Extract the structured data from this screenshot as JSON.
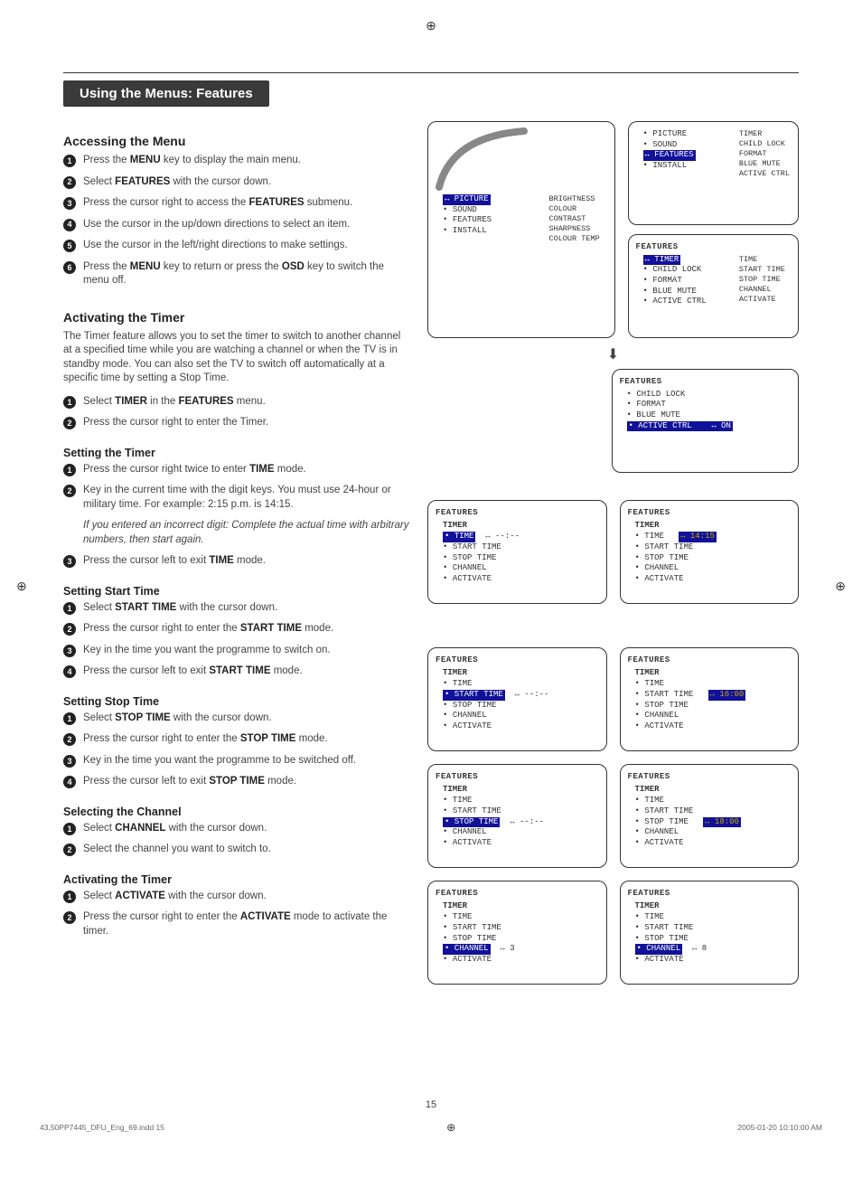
{
  "page_number": "15",
  "print_mark_glyph": "⊕",
  "title_bar": "Using the Menus: Features",
  "footer_left": "43,50PP7445_DFU_Eng_69.indd   15",
  "footer_right": "2005-01-20   10:10:00 AM",
  "sections": {
    "accessing": {
      "heading": "Accessing the Menu",
      "steps": [
        "Press the <b class='kw'>MENU</b> key to display the main menu.",
        "Select <b class='kw'>FEATURES</b> with the cursor down.",
        "Press the cursor right to access the <b class='kw'>FEATURES</b> submenu.",
        "Use the cursor in the up/down directions to select an item.",
        "Use the cursor in the left/right directions to make settings.",
        "Press the <b class='kw'>MENU</b> key to return or press the <b class='kw'>OSD</b> key to switch the menu off."
      ]
    },
    "activating_timer_intro": {
      "heading": "Activating the Timer",
      "intro": "The Timer feature allows you to set the timer to switch to another channel at a specified time while you are watching a channel or when the TV is in standby mode. You can also set the TV to switch off automatically at a specific time by setting a Stop Time.",
      "steps": [
        "Select <b class='kw'>TIMER</b> in the <b class='kw'>FEATURES</b> menu.",
        "Press the cursor right to enter the Timer."
      ]
    },
    "setting_timer": {
      "heading": "Setting the Timer",
      "steps": [
        "Press the cursor right twice to enter <b class='kw'>TIME</b> mode.",
        "Key in the current time with the digit keys. You must use 24-hour or military time. For example: 2:15 p.m. is 14:15.",
        "Press the cursor left to exit <b class='kw'>TIME</b> mode."
      ],
      "note": "If you entered an incorrect digit: Complete the actual time with arbitrary numbers, then start again."
    },
    "setting_start": {
      "heading": "Setting Start Time",
      "steps": [
        "Select <b class='kw'>START TIME</b> with the cursor down.",
        "Press the cursor right to enter the <b class='kw'>START TIME</b> mode.",
        "Key in the time you want the programme to switch on.",
        "Press the cursor left to exit <b class='kw'>START TIME</b> mode."
      ]
    },
    "setting_stop": {
      "heading": "Setting Stop Time",
      "steps": [
        "Select <b class='kw'>STOP TIME</b> with the cursor down.",
        "Press the cursor right to enter the <b class='kw'>STOP TIME</b> mode.",
        "Key in the time you want the programme to be switched off.",
        "Press the cursor left to exit <b class='kw'>STOP TIME</b> mode."
      ]
    },
    "selecting_channel": {
      "heading": "Selecting the Channel",
      "steps": [
        "Select <b class='kw'>CHANNEL</b> with the cursor down.",
        "Select the channel you want to switch to."
      ]
    },
    "activating_timer2": {
      "heading": "Activating the Timer",
      "steps": [
        "Select <b class='kw'>ACTIVATE</b> with the cursor down.",
        "Press the cursor right to enter the <b class='kw'>ACTIVATE</b> mode to activate the timer."
      ]
    }
  },
  "screens": {
    "main_menu": {
      "left_items": [
        "PICTURE",
        "SOUND",
        "FEATURES",
        "INSTALL"
      ],
      "left_selected": "PICTURE",
      "right_items": [
        "BRIGHTNESS",
        "COLOUR",
        "CONTRAST",
        "SHARPNESS",
        "COLOUR TEMP"
      ]
    },
    "features_top": {
      "left_items": [
        "PICTURE",
        "SOUND",
        "FEATURES",
        "INSTALL"
      ],
      "left_selected": "FEATURES",
      "right_items": [
        "TIMER",
        "CHILD LOCK",
        "FORMAT",
        "BLUE MUTE",
        "ACTIVE CTRL"
      ]
    },
    "features_sub": {
      "title": "FEATURES",
      "left_items": [
        "TIMER",
        "CHILD LOCK",
        "FORMAT",
        "BLUE MUTE",
        "ACTIVE CTRL"
      ],
      "left_selected": "TIMER",
      "right_items": [
        "TIME",
        "START TIME",
        "STOP TIME",
        "CHANNEL",
        "ACTIVATE"
      ]
    },
    "active_ctrl": {
      "title": "FEATURES",
      "items": [
        "CHILD LOCK",
        "FORMAT",
        "BLUE MUTE",
        "ACTIVE CTRL"
      ],
      "selected": "ACTIVE CTRL",
      "value": "↔ ON"
    },
    "timer_time_left": {
      "title": "FEATURES",
      "sub": "TIMER",
      "items": [
        "TIME",
        "START TIME",
        "STOP TIME",
        "CHANNEL",
        "ACTIVATE"
      ],
      "selected": "TIME",
      "value": "↔ --:--"
    },
    "timer_time_right": {
      "title": "FEATURES",
      "sub": "TIMER",
      "items": [
        "TIME",
        "START TIME",
        "STOP TIME",
        "CHANNEL",
        "ACTIVATE"
      ],
      "selected_value_item": "TIME",
      "value": "↔ 14:15"
    },
    "start_left": {
      "title": "FEATURES",
      "sub": "TIMER",
      "items": [
        "TIME",
        "START TIME",
        "STOP TIME",
        "CHANNEL",
        "ACTIVATE"
      ],
      "selected": "START TIME",
      "value": "↔ --:--"
    },
    "start_right": {
      "title": "FEATURES",
      "sub": "TIMER",
      "items": [
        "TIME",
        "START TIME",
        "STOP TIME",
        "CHANNEL",
        "ACTIVATE"
      ],
      "selected_value_item": "START TIME",
      "value": "↔ 16:00"
    },
    "stop_left": {
      "title": "FEATURES",
      "sub": "TIMER",
      "items": [
        "TIME",
        "START TIME",
        "STOP TIME",
        "CHANNEL",
        "ACTIVATE"
      ],
      "selected": "STOP TIME",
      "value": "↔ --:--"
    },
    "stop_right": {
      "title": "FEATURES",
      "sub": "TIMER",
      "items": [
        "TIME",
        "START TIME",
        "STOP TIME",
        "CHANNEL",
        "ACTIVATE"
      ],
      "selected_value_item": "STOP TIME",
      "value": "↔ 18:00"
    },
    "chan_left": {
      "title": "FEATURES",
      "sub": "TIMER",
      "items": [
        "TIME",
        "START TIME",
        "STOP TIME",
        "CHANNEL",
        "ACTIVATE"
      ],
      "selected": "CHANNEL",
      "value": "↔ 3"
    },
    "chan_right": {
      "title": "FEATURES",
      "sub": "TIMER",
      "items": [
        "TIME",
        "START TIME",
        "STOP TIME",
        "CHANNEL",
        "ACTIVATE"
      ],
      "selected": "CHANNEL",
      "value": "↔ 8"
    }
  }
}
